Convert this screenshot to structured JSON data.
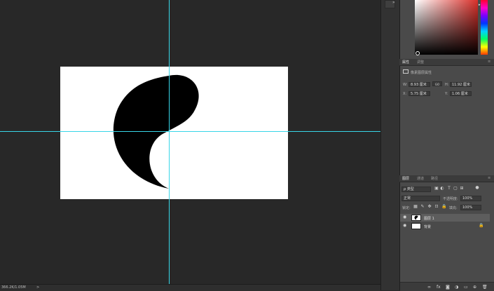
{
  "status": {
    "doc_info": "366.2K/1.05M",
    "arrow": ">"
  },
  "properties": {
    "tabs": [
      {
        "label": "属性"
      },
      {
        "label": "调整"
      }
    ],
    "type_label": "像素图层属性",
    "w_label": "W:",
    "w_value": "8.93 厘米",
    "h_label": "H:",
    "h_value": "11.92 厘米",
    "x_label": "X:",
    "x_value": "5.75 厘米",
    "y_label": "Y:",
    "y_value": "1.06 厘米",
    "link_icon": "GO"
  },
  "layers": {
    "tabs": [
      {
        "label": "图层"
      },
      {
        "label": "通道"
      },
      {
        "label": "路径"
      }
    ],
    "filter_value": "ρ 类型",
    "blend_mode": "正常",
    "opacity_label": "不透明度:",
    "opacity_value": "100%",
    "lock_label": "锁定:",
    "fill_label": "填充:",
    "fill_value": "100%",
    "items": [
      {
        "name": "图层 1",
        "selected": true
      },
      {
        "name": "背景",
        "selected": false
      }
    ]
  },
  "colors": {
    "guide": "#38d6e8",
    "selected_row": "#5d5d5d"
  },
  "icons": [
    "eye-icon",
    "link-icon",
    "lock-icon",
    "fx-icon",
    "mask-icon",
    "folder-icon",
    "new-layer-icon",
    "trash-icon",
    "menu-icon"
  ]
}
